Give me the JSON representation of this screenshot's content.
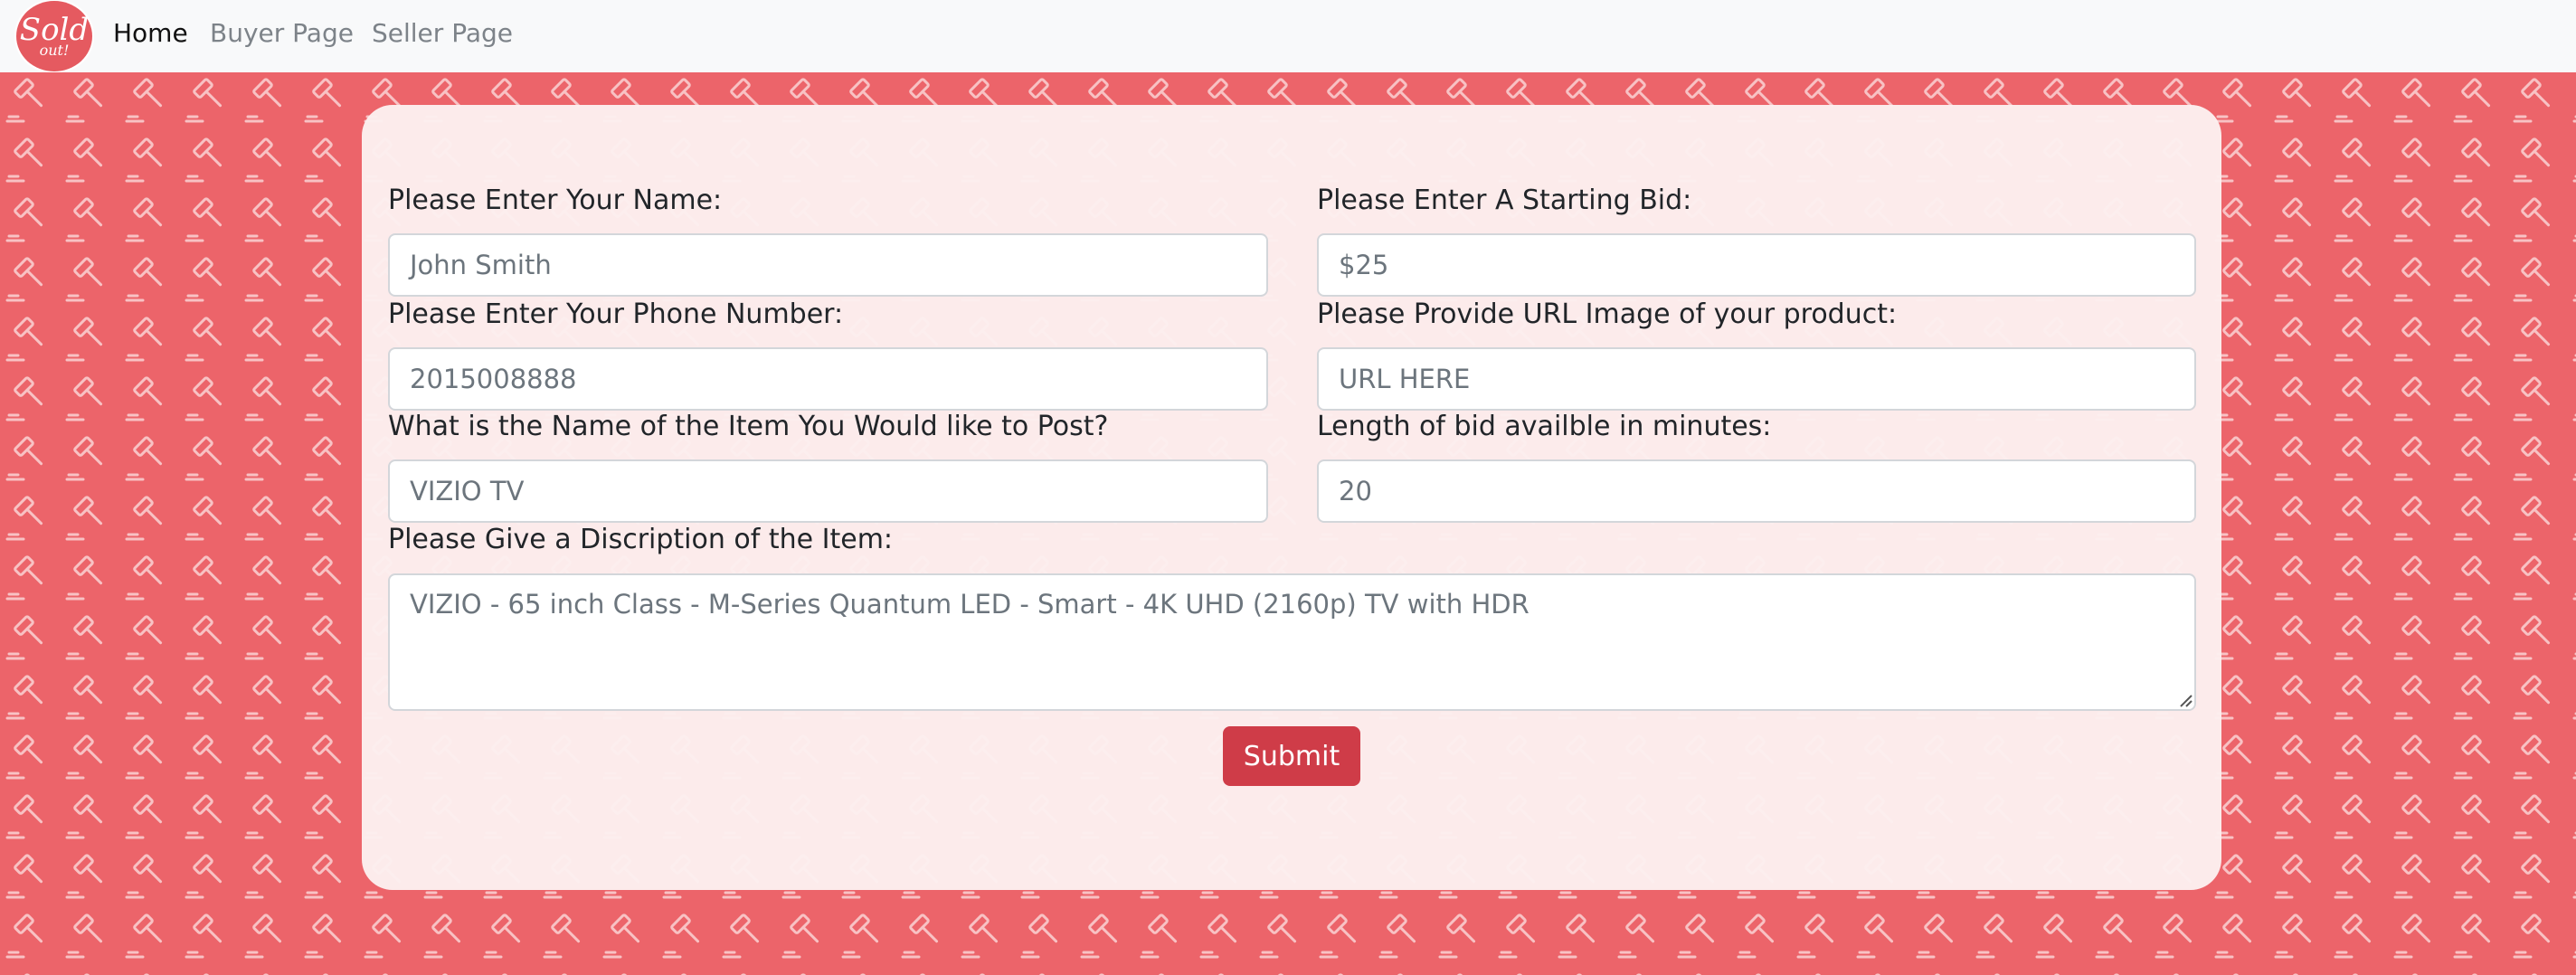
{
  "brand": {
    "logo_text": "Sold",
    "logo_subtext": "out!",
    "accent_color": "#ec646a",
    "button_color": "#cf3c48"
  },
  "nav": {
    "items": [
      {
        "label": "Home",
        "active": true
      },
      {
        "label": "Buyer Page",
        "active": false
      },
      {
        "label": "Seller Page",
        "active": false
      }
    ]
  },
  "background": {
    "pattern_icon": "gavel-icon"
  },
  "form": {
    "name": {
      "label": "Please Enter Your Name:",
      "placeholder": "John Smith"
    },
    "starting_bid": {
      "label": "Please Enter A Starting Bid:",
      "placeholder": "$25"
    },
    "phone": {
      "label": "Please Enter Your Phone Number:",
      "placeholder": "2015008888"
    },
    "image_url": {
      "label": "Please Provide URL Image of your product:",
      "placeholder": "URL HERE"
    },
    "item_name": {
      "label": "What is the Name of the Item You Would like to Post?",
      "placeholder": "VIZIO TV"
    },
    "bid_length": {
      "label": "Length of bid availble in minutes:",
      "placeholder": "20"
    },
    "description": {
      "label": "Please Give a Discription of the Item:",
      "placeholder": "VIZIO - 65 inch Class - M-Series Quantum LED - Smart - 4K UHD (2160p) TV with HDR"
    },
    "submit_label": "Submit"
  }
}
